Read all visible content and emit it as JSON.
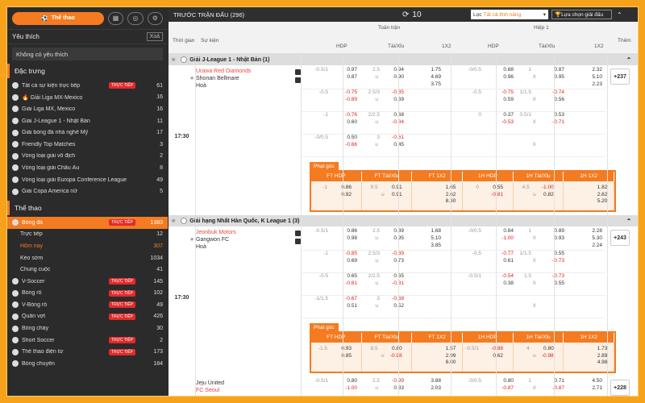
{
  "sidebar": {
    "sport_button": "Thể thao",
    "favorites": {
      "title": "Yêu thích",
      "clear": "Xoá",
      "empty": "Không có yêu thích"
    },
    "featured": {
      "title": "Đặc trưng",
      "items": [
        {
          "label": "Tất cả sự kiện trực tiếp",
          "live": "TRỰC TIẾP",
          "count": "61"
        },
        {
          "label": "🔥 Giải Liga MX-Mexico",
          "count": "16"
        },
        {
          "label": "Giải Liga MX, Mexico",
          "count": "16"
        },
        {
          "label": "Giải J-League 1 - Nhật Bản",
          "count": "11"
        },
        {
          "label": "Giải bóng đá nhà nghề Mỹ",
          "count": "17"
        },
        {
          "label": "Friendly Top Matches",
          "count": "3"
        },
        {
          "label": "Vòng loại giải vô địch",
          "count": "2"
        },
        {
          "label": "Vòng loại giải Châu Âu",
          "count": "8"
        },
        {
          "label": "Vòng loại giải Europa Conference League",
          "count": "49"
        },
        {
          "label": "Giải Copa America nữ",
          "count": "5"
        }
      ]
    },
    "sports": {
      "title": "Thể thao",
      "items": [
        {
          "label": "Bóng đá",
          "live": "TRỰC TIẾP",
          "count": "1383",
          "type": "active"
        },
        {
          "label": "Trực tiếp",
          "count": "12",
          "type": "sub"
        },
        {
          "label": "Hôm nay",
          "count": "307",
          "type": "sub-orange"
        },
        {
          "label": "Kèo sớm",
          "count": "1034",
          "type": "sub"
        },
        {
          "label": "Chung cuộc",
          "count": "41",
          "type": "sub"
        },
        {
          "label": "V-Soccer",
          "live": "TRỰC TIẾP",
          "count": "145"
        },
        {
          "label": "Bóng rổ",
          "live": "TRỰC TIẾP",
          "count": "102"
        },
        {
          "label": "V-Bóng rổ",
          "live": "TRỰC TIẾP",
          "count": "49"
        },
        {
          "label": "Quần vợt",
          "live": "TRỰC TIẾP",
          "count": "426"
        },
        {
          "label": "Bóng chày",
          "count": "30"
        },
        {
          "label": "Short Soccer",
          "live": "TRỰC TIẾP",
          "count": "2"
        },
        {
          "label": "Thể thao điện tử",
          "live": "TRỰC TIẾP",
          "count": "173"
        },
        {
          "label": "Bóng chuyền",
          "count": "184"
        }
      ]
    }
  },
  "header": {
    "title": "TRƯỚC TRẬN ĐẤU (296)",
    "refresh": "10",
    "filter_label": "Lọc",
    "filter_value": "Tất cả tỉnh năng",
    "select_league": "Lựa chọn giải đấu"
  },
  "columns": {
    "time": "Thời gian",
    "event": "Sự kiện",
    "full": "Toàn trận",
    "half": "Hiệp 1",
    "hdp": "HDP",
    "ou": "Tài/Xỉu",
    "x12": "1X2",
    "hdp2": "HDP",
    "ou2": "Tài/Xỉu",
    "x122": "1X2",
    "more": "Thêm"
  },
  "leagues": [
    {
      "name": "Giải J-League 1 - Nhật Bản (1)",
      "time": "17:30",
      "home": "Urawa Red Diamonds",
      "away": "Shonan Bellmare",
      "draw": "Hoà",
      "more": "+237",
      "rows": [
        [
          "-0.5/1",
          "0.97",
          "0.87",
          "2.5",
          "0.94",
          "0.90",
          "u",
          "1.75",
          "4.69",
          "3.75",
          "-0/0.5",
          "0.88",
          "0.96",
          "1",
          "0.87",
          "0.95",
          "u",
          "2.32",
          "5.10",
          "2.23"
        ],
        [
          "-0.5",
          "-0.75",
          "-0.89",
          "2.5/3",
          "-0.85",
          "0.69",
          "u",
          "",
          "",
          "",
          "-0.5",
          "-0.75",
          "0.59",
          "1/1.5",
          "-0.74",
          "0.56",
          "u",
          "",
          "",
          ""
        ],
        [
          "-1",
          "-0.76",
          "0.60",
          "2/2.5",
          "0.68",
          "-0.84",
          "u",
          "",
          "",
          "",
          "0",
          "0.37",
          "-0.53",
          "0.5/1",
          "0.53",
          "-0.71",
          "u",
          "",
          "",
          ""
        ],
        [
          "-0/0.5",
          "0.50",
          "-0.66",
          "3",
          "-0.61",
          "0.45",
          "u",
          "",
          "",
          "",
          "",
          "",
          "",
          "",
          "",
          "",
          "",
          "",
          "",
          ""
        ]
      ],
      "corner_label": "Phạt góc",
      "corner_heads": [
        "FT HDP",
        "FT Tài/Xỉu",
        "FT 1X2",
        "1H HDP",
        "1H Tài/Xỉu",
        "1H 1X2"
      ],
      "corner": [
        [
          "-1",
          "0.86",
          "0.92"
        ],
        [
          "9.5",
          "0.91",
          "0.91",
          "u"
        ],
        [
          "1.65",
          "2.62",
          "8.30"
        ],
        [
          "0",
          "0.55",
          "-0.81"
        ],
        [
          "4.5",
          "-1.00",
          "0.82",
          "u"
        ],
        [
          "1.82",
          "2.62",
          "5.20"
        ]
      ]
    },
    {
      "name": "Giải hạng Nhất Hàn Quốc, K League 1 (3)",
      "time": "17:30",
      "home": "Jeonbuk Motors",
      "away": "Gangwon FC",
      "draw": "Hoà",
      "more": "+243",
      "rows": [
        [
          "-0.5/1",
          "0.86",
          "0.98",
          "2.5",
          "0.89",
          "0.95",
          "u",
          "1.68",
          "5.10",
          "3.85",
          "-0/0.5",
          "0.84",
          "-1.00",
          "1",
          "0.89",
          "0.93",
          "u",
          "2.28",
          "5.30",
          "2.24"
        ],
        [
          "-1",
          "-0.85",
          "0.69",
          "2.5/3",
          "-0.89",
          "0.73",
          "u",
          "",
          "",
          "",
          "-0.5",
          "-0.77",
          "0.61",
          "1/1.5",
          "0.55",
          "-0.73",
          "u",
          "",
          "",
          ""
        ],
        [
          "-0.5",
          "0.65",
          "-0.81",
          "2/2.5",
          "0.65",
          "-0.81",
          "u",
          "",
          "",
          "",
          "-0.5/1",
          "-0.54",
          "0.38",
          "1.5",
          "-0.73",
          "0.55",
          "u",
          "",
          "",
          ""
        ],
        [
          "-1/1.5",
          "-0.67",
          "0.51",
          "3",
          "-0.68",
          "0.52",
          "u",
          "",
          "",
          "",
          "",
          "",
          "",
          "",
          "",
          "",
          "",
          "",
          "",
          ""
        ]
      ],
      "corner_label": "Phạt góc",
      "corner_heads": [
        "FT HDP",
        "FT Tài/Xỉu",
        "FT 1X2",
        "1H HDP",
        "1H Tài/Xỉu",
        "1H 1X2"
      ],
      "corner": [
        [
          "-1.5",
          "0.93",
          "0.85"
        ],
        [
          "8.5",
          "0.80",
          "-0.98",
          "u"
        ],
        [
          "1.57",
          "2.99",
          "8.00"
        ],
        [
          "-0.5/1",
          "-0.88",
          "0.62"
        ],
        [
          "4",
          "0.80",
          "-0.98",
          "u"
        ],
        [
          "1.73",
          "2.89",
          "4.98"
        ]
      ]
    }
  ],
  "third": {
    "home": "Jeju United",
    "away": "FC Seoul",
    "r1": [
      "-0.5/1",
      "0.80",
      "-1.00",
      "2.5",
      "-0.99",
      "0.83",
      "u",
      "3.88",
      "2.03",
      "",
      "-0/0.5",
      "0.80",
      "-0.87",
      "1",
      "0.71",
      "-0.87",
      "u",
      "4.50",
      "2.71",
      ""
    ],
    "more": "+228"
  }
}
